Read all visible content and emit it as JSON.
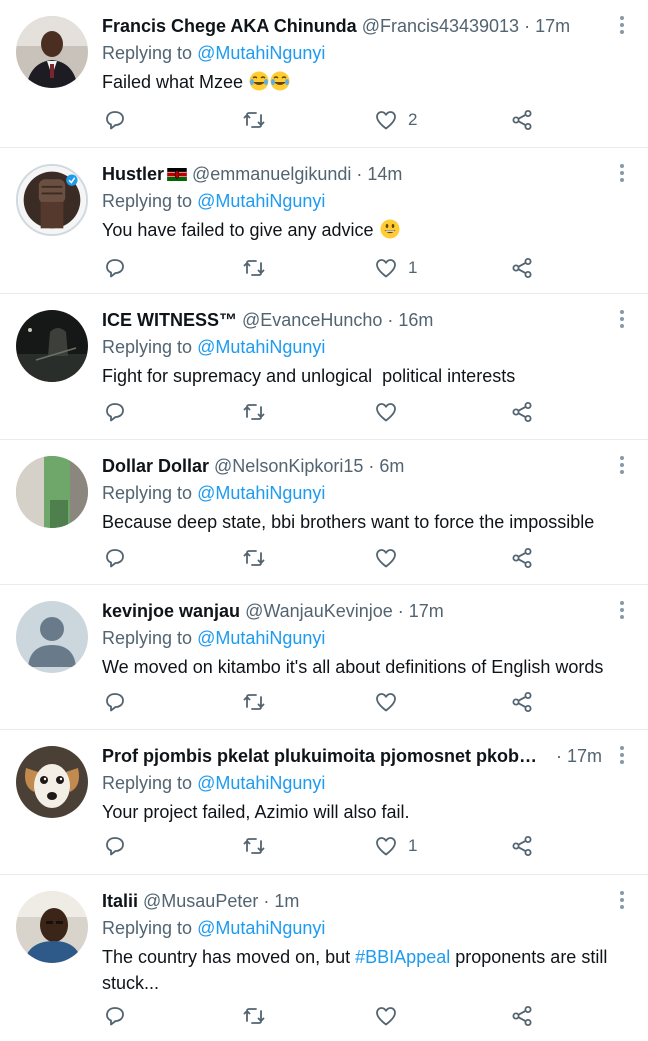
{
  "tweets": [
    {
      "name": "Francis Chege AKA Chinunda",
      "handle": "@Francis43439013",
      "time": "· 17m",
      "replying_prefix": "Replying to",
      "replying_to": "@MutahiNgunyi",
      "text": "Failed what Mzee",
      "text_after": "",
      "hashtag": "",
      "emoji": "joy-emoji x2",
      "likes": "2",
      "avatar": "man-in-suit-avatar"
    },
    {
      "name": "Hustler",
      "handle": "@emmanuelgikundi",
      "time": "· 14m",
      "replying_prefix": "Replying to",
      "replying_to": "@MutahiNgunyi",
      "text": "You have failed to give any advice",
      "text_after": "",
      "hashtag": "",
      "emoji": "grin-emoji",
      "likes": "1",
      "avatar": "raised-fist-avatar",
      "flag": "kenya-flag-icon"
    },
    {
      "name": "ICE WITNESS™",
      "handle": "@EvanceHuncho",
      "time": "· 16m",
      "replying_prefix": "Replying to",
      "replying_to": "@MutahiNgunyi",
      "text": "Fight for supremacy and unlogical  political interests",
      "text_after": "",
      "hashtag": "",
      "likes": "",
      "avatar": "dark-night-avatar"
    },
    {
      "name": "Dollar Dollar",
      "handle": "@NelsonKipkori15",
      "time": "· 6m",
      "replying_prefix": "Replying to",
      "replying_to": "@MutahiNgunyi",
      "text": "Because deep state, bbi brothers want to force the impossible",
      "text_after": "",
      "hashtag": "",
      "likes": "",
      "avatar": "green-wall-avatar"
    },
    {
      "name": "kevinjoe wanjau",
      "handle": "@WanjauKevinjoe",
      "time": "· 17m",
      "replying_prefix": "Replying to",
      "replying_to": "@MutahiNgunyi",
      "text": "We moved on kitambo it's all about definitions of English words",
      "text_after": "",
      "hashtag": "",
      "likes": "",
      "avatar": "default-user-avatar"
    },
    {
      "name": "Prof pjombis pkelat plukuimoita pjomosnet pkobwegei",
      "handle": "",
      "time": "· 17m",
      "replying_prefix": "Replying to",
      "replying_to": "@MutahiNgunyi",
      "text": "Your project failed, Azimio will also fail.",
      "text_after": "",
      "hashtag": "",
      "likes": "1",
      "avatar": "dog-avatar"
    },
    {
      "name": "Italii",
      "handle": "@MusauPeter",
      "time": "· 1m",
      "replying_prefix": "Replying to",
      "replying_to": "@MutahiNgunyi",
      "text": "The country has moved on, but ",
      "hashtag": "#BBIAppeal",
      "text_after": " proponents are still stuck...",
      "likes": "",
      "avatar": "man-selfie-avatar"
    }
  ],
  "colors": {
    "link": "#1d9bf0",
    "secondary_text": "#536471",
    "primary_text": "#0f1419",
    "divider": "#e6ecf0"
  },
  "icons": [
    "reply-icon",
    "retweet-icon",
    "like-icon",
    "share-icon",
    "more-icon"
  ]
}
